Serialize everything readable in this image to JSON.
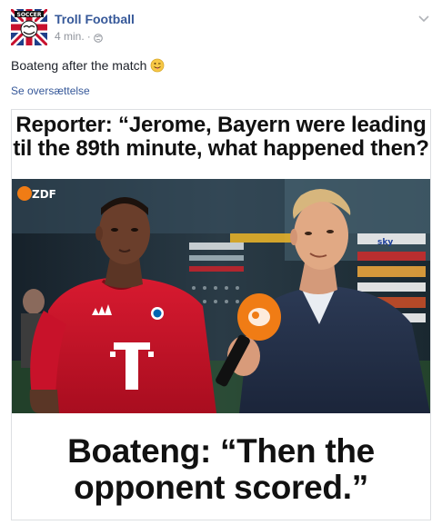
{
  "post": {
    "page_name": "Troll Football",
    "timestamp": "4 min.",
    "separator": "·",
    "text": "Boateng after the match",
    "emoji_icon": "face-with-tongue-emoji-icon",
    "translation_link": "Se oversættelse",
    "avatar_label": "SOCCER"
  },
  "media": {
    "caption_top": "Reporter: “Jerome, Bayern were leading til the 89th minute, what happened then?",
    "caption_bottom": "Boateng: “Then the opponent scored.”",
    "channel_logo": "ZDF",
    "banner_text": "sky"
  },
  "colors": {
    "link_blue": "#365899",
    "meta_grey": "#90949c",
    "text_dark": "#1d2129",
    "jersey_red": "#d0112b",
    "stadium_dark": "#1c2a33"
  }
}
